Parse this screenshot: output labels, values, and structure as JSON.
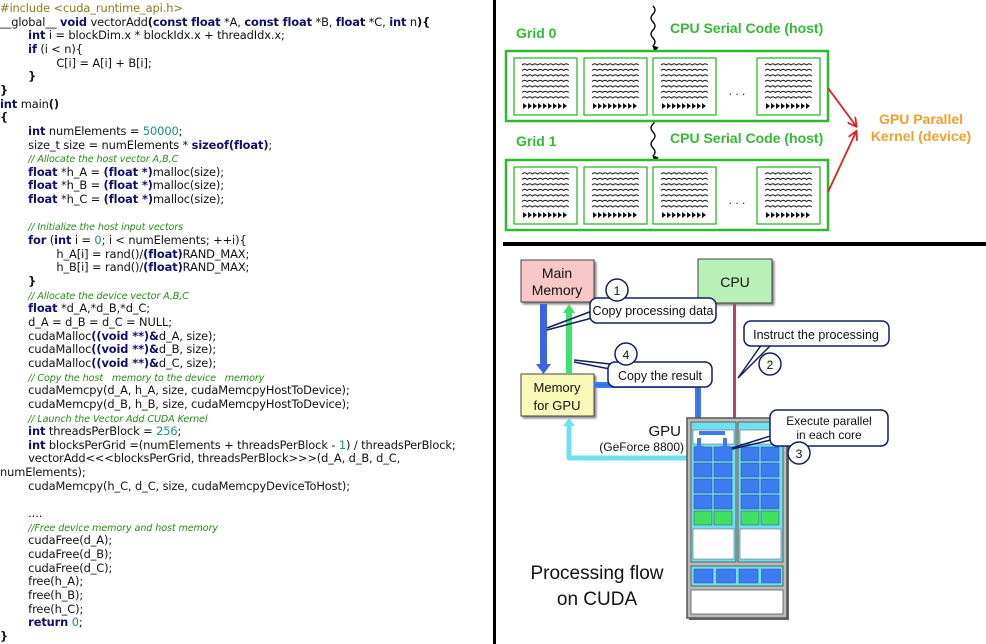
{
  "code": {
    "lines": [
      [
        {
          "t": "#include <cuda_runtime_api.h>",
          "c": "pp"
        }
      ],
      [
        {
          "t": "__global__ "
        },
        {
          "t": "void",
          "c": "kw"
        },
        {
          "t": " vectorAdd"
        },
        {
          "t": "(",
          "c": "pn"
        },
        {
          "t": "const float",
          "c": "kw"
        },
        {
          "t": " *A, "
        },
        {
          "t": "const float",
          "c": "kw"
        },
        {
          "t": " *B, "
        },
        {
          "t": "float",
          "c": "kw"
        },
        {
          "t": " *C, "
        },
        {
          "t": "int",
          "c": "kw"
        },
        {
          "t": " n"
        },
        {
          "t": "){",
          "c": "pn"
        }
      ],
      [
        {
          "t": "        "
        },
        {
          "t": "int",
          "c": "kw"
        },
        {
          "t": " i = blockDim.x * blockIdx.x + threadIdx.x;"
        }
      ],
      [
        {
          "t": "        "
        },
        {
          "t": "if",
          "c": "kw"
        },
        {
          "t": " (i < n){"
        }
      ],
      [
        {
          "t": "                C[i] = A[i] + B[i];"
        }
      ],
      [
        {
          "t": "        "
        },
        {
          "t": "}",
          "c": "pn"
        }
      ],
      [
        {
          "t": "}",
          "c": "pn"
        }
      ],
      [
        {
          "t": "int",
          "c": "kw"
        },
        {
          "t": " main"
        },
        {
          "t": "()",
          "c": "pn"
        }
      ],
      [
        {
          "t": "{",
          "c": "pn"
        }
      ],
      [
        {
          "t": "        "
        },
        {
          "t": "int",
          "c": "kw"
        },
        {
          "t": " numElements = "
        },
        {
          "t": "50000",
          "c": "num"
        },
        {
          "t": ";"
        }
      ],
      [
        {
          "t": "        size_t size = numElements * "
        },
        {
          "t": "sizeof(float)",
          "c": "kw"
        },
        {
          "t": ";"
        }
      ],
      [
        {
          "t": "        "
        },
        {
          "t": "// Allocate the host vector A,B,C",
          "c": "cm"
        }
      ],
      [
        {
          "t": "        "
        },
        {
          "t": "float",
          "c": "kw"
        },
        {
          "t": " *h_A = "
        },
        {
          "t": "(float *)",
          "c": "kw"
        },
        {
          "t": "malloc(size);"
        }
      ],
      [
        {
          "t": "        "
        },
        {
          "t": "float",
          "c": "kw"
        },
        {
          "t": " *h_B = "
        },
        {
          "t": "(float *)",
          "c": "kw"
        },
        {
          "t": "malloc(size);"
        }
      ],
      [
        {
          "t": "        "
        },
        {
          "t": "float",
          "c": "kw"
        },
        {
          "t": " *h_C = "
        },
        {
          "t": "(float *)",
          "c": "kw"
        },
        {
          "t": "malloc(size);"
        }
      ],
      [
        {
          "t": ""
        }
      ],
      [
        {
          "t": "        "
        },
        {
          "t": "// Initialize the host input vectors",
          "c": "cm"
        }
      ],
      [
        {
          "t": "        "
        },
        {
          "t": "for",
          "c": "kw"
        },
        {
          "t": " ("
        },
        {
          "t": "int",
          "c": "kw"
        },
        {
          "t": " i = "
        },
        {
          "t": "0",
          "c": "num"
        },
        {
          "t": "; i < numElements; ++i){"
        }
      ],
      [
        {
          "t": "                h_A[i] = rand()/"
        },
        {
          "t": "(float)",
          "c": "kw"
        },
        {
          "t": "RAND_MAX;"
        }
      ],
      [
        {
          "t": "                h_B[i] = rand()/"
        },
        {
          "t": "(float)",
          "c": "kw"
        },
        {
          "t": "RAND_MAX;"
        }
      ],
      [
        {
          "t": "        "
        },
        {
          "t": "}",
          "c": "pn"
        }
      ],
      [
        {
          "t": "        "
        },
        {
          "t": "// Allocate the device vector A,B,C",
          "c": "cm"
        }
      ],
      [
        {
          "t": "        "
        },
        {
          "t": "float",
          "c": "kw"
        },
        {
          "t": " *d_A,*d_B,*d_C;"
        }
      ],
      [
        {
          "t": "        d_A = d_B = d_C = NULL;"
        }
      ],
      [
        {
          "t": "        cudaMalloc"
        },
        {
          "t": "((void **)&",
          "c": "kw"
        },
        {
          "t": "d_A, size);"
        }
      ],
      [
        {
          "t": "        cudaMalloc"
        },
        {
          "t": "((void **)&",
          "c": "kw"
        },
        {
          "t": "d_B, size);"
        }
      ],
      [
        {
          "t": "        cudaMalloc"
        },
        {
          "t": "((void **)&",
          "c": "kw"
        },
        {
          "t": "d_C, size);"
        }
      ],
      [
        {
          "t": "        "
        },
        {
          "t": "// Copy the host   memory to the device   memory",
          "c": "cm"
        }
      ],
      [
        {
          "t": "        cudaMemcpy(d_A, h_A, size, cudaMemcpyHostToDevice);"
        }
      ],
      [
        {
          "t": "        cudaMemcpy(d_B, h_B, size, cudaMemcpyHostToDevice);"
        }
      ],
      [
        {
          "t": "        "
        },
        {
          "t": "// Launch the Vector Add CUDA Kernel",
          "c": "cm"
        }
      ],
      [
        {
          "t": "        "
        },
        {
          "t": "int",
          "c": "kw"
        },
        {
          "t": " threadsPerBlock = "
        },
        {
          "t": "256",
          "c": "num"
        },
        {
          "t": ";"
        }
      ],
      [
        {
          "t": "        "
        },
        {
          "t": "int",
          "c": "kw"
        },
        {
          "t": " blocksPerGrid =(numElements + threadsPerBlock - "
        },
        {
          "t": "1",
          "c": "num"
        },
        {
          "t": ") / threadsPerBlock;"
        }
      ],
      [
        {
          "t": "        vectorAdd<<<blocksPerGrid, threadsPerBlock>>>(d_A, d_B, d_C,"
        }
      ],
      [
        {
          "t": "numElements);"
        }
      ],
      [
        {
          "t": "        cudaMemcpy(h_C, d_C, size, cudaMemcpyDeviceToHost);"
        }
      ],
      [
        {
          "t": ""
        }
      ],
      [
        {
          "t": "        ...."
        }
      ],
      [
        {
          "t": "        "
        },
        {
          "t": "//Free device memory and host memory",
          "c": "cm"
        }
      ],
      [
        {
          "t": "        cudaFree(d_A);"
        }
      ],
      [
        {
          "t": "        cudaFree(d_B);"
        }
      ],
      [
        {
          "t": "        cudaFree(d_C);"
        }
      ],
      [
        {
          "t": "        free(h_A);"
        }
      ],
      [
        {
          "t": "        free(h_B);"
        }
      ],
      [
        {
          "t": "        free(h_C);"
        }
      ],
      [
        {
          "t": "        "
        },
        {
          "t": "return",
          "c": "kw"
        },
        {
          "t": " "
        },
        {
          "t": "0",
          "c": "num"
        },
        {
          "t": ";"
        }
      ],
      [
        {
          "t": "}",
          "c": "pn"
        }
      ]
    ]
  },
  "grid_diagram": {
    "grid0_label": "Grid 0",
    "grid1_label": "Grid 1",
    "serial_label_0": "CPU Serial Code (host)",
    "serial_label_1": "CPU Serial Code (host)",
    "kernel_label_line1": "GPU Parallel",
    "kernel_label_line2": "Kernel (device)",
    "ellipsis": ". . .",
    "colors": {
      "green": "#2eb82e",
      "label_green": "#33bb33",
      "orange": "#f0a030",
      "red": "#e02020"
    }
  },
  "cuda_flow": {
    "main_memory_line1": "Main",
    "main_memory_line2": "Memory",
    "cpu_label": "CPU",
    "gpu_memory_line1": "Memory",
    "gpu_memory_line2": "for GPU",
    "gpu_label": "GPU",
    "gpu_model": "(GeForce 8800)",
    "steps": [
      {
        "num": "1",
        "text": "Copy processing data"
      },
      {
        "num": "2",
        "text": "Instruct the processing"
      },
      {
        "num": "3",
        "text_line1": "Execute parallel",
        "text_line2": "in each core"
      },
      {
        "num": "4",
        "text": "Copy the result"
      }
    ],
    "caption_line1": "Processing flow",
    "caption_line2": "on CUDA",
    "colors": {
      "main_memory": "#f8c8c8",
      "cpu": "#b8f0b8",
      "gpu_memory": "#fafab8",
      "core_blue": "#3c7cf0",
      "core_green": "#40e060",
      "cyan": "#70e0f0"
    }
  }
}
